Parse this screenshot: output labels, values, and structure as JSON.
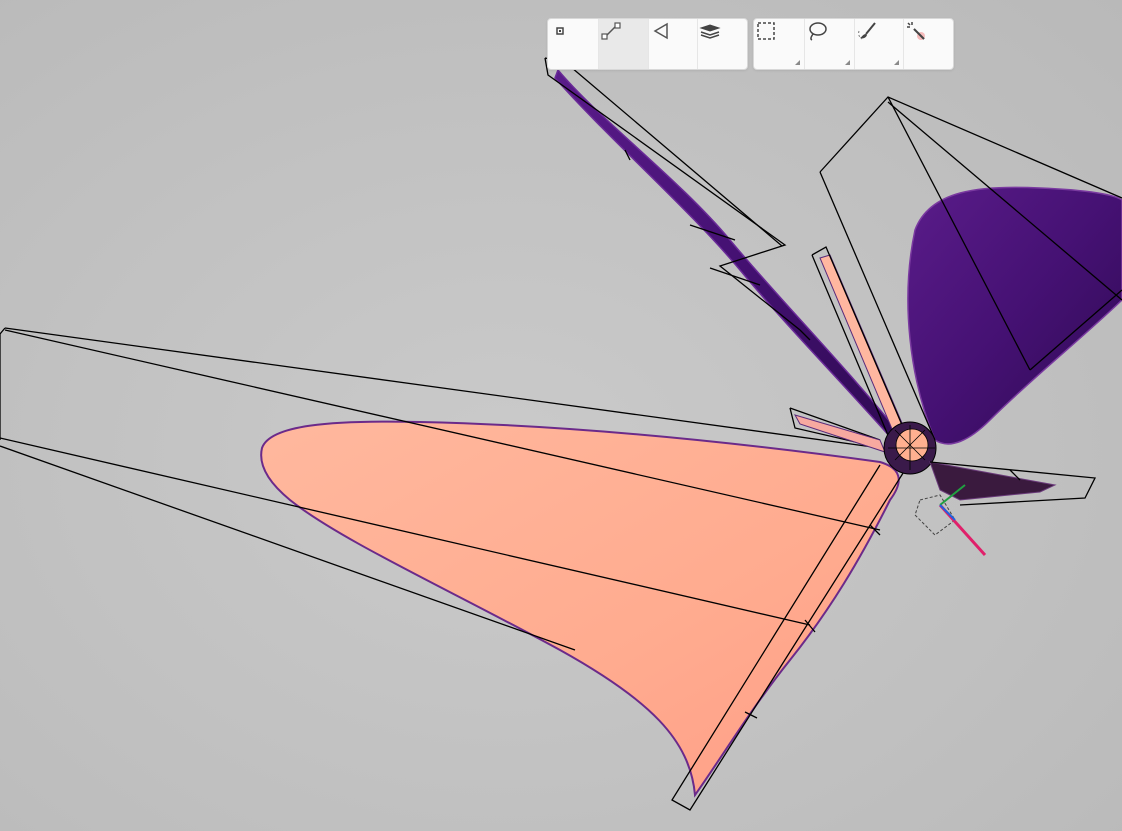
{
  "toolbar": {
    "select_mode": [
      {
        "name": "vertex-select-button",
        "icon": "vertex-icon",
        "active": false
      },
      {
        "name": "edge-select-button",
        "icon": "edge-icon",
        "active": true
      },
      {
        "name": "face-select-button",
        "icon": "face-icon",
        "active": false
      },
      {
        "name": "object-select-button",
        "icon": "layers-icon",
        "active": false
      }
    ],
    "select_tools": [
      {
        "name": "box-select-button",
        "icon": "dashed-rectangle-icon",
        "has_submenu": true
      },
      {
        "name": "lasso-select-button",
        "icon": "lasso-icon",
        "has_submenu": true
      },
      {
        "name": "paint-select-button",
        "icon": "brush-icon",
        "has_submenu": true
      },
      {
        "name": "magic-select-button",
        "icon": "magic-wand-icon",
        "has_submenu": false
      }
    ]
  },
  "viewport": {
    "background": "#c2c2c2",
    "surface_colors": {
      "salmon": "#ffae94",
      "purple": "#4a1478",
      "cage": "#000000"
    }
  }
}
